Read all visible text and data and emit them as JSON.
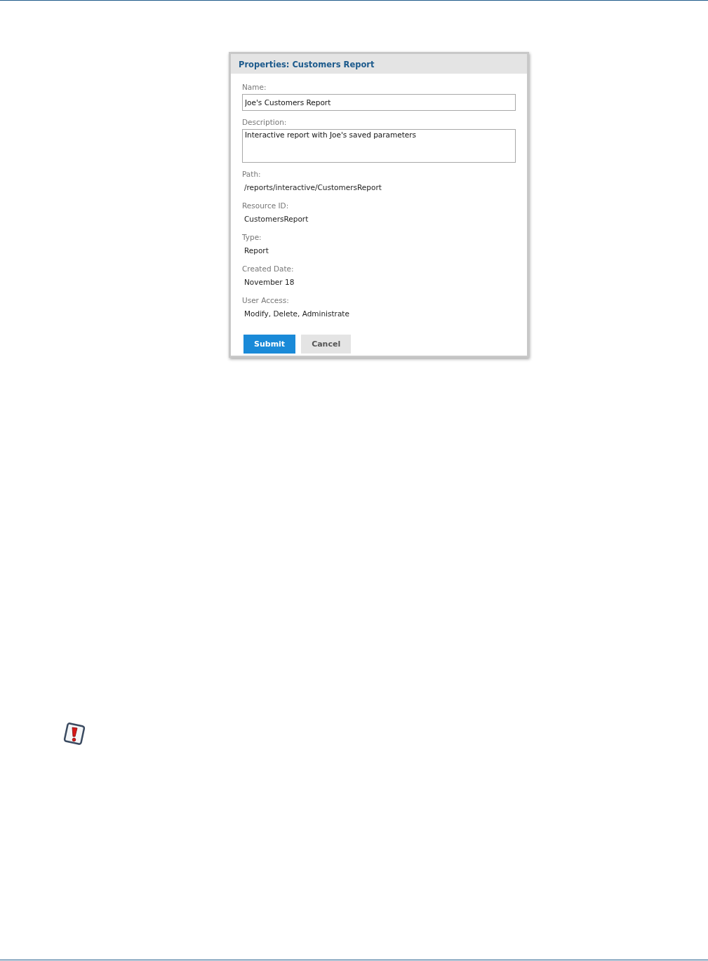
{
  "dialog": {
    "title": "Properties: Customers Report",
    "fields": [
      {
        "kind": "input",
        "label": "Name:",
        "value": "Joe's Customers Report"
      },
      {
        "kind": "textarea",
        "label": "Description:",
        "value": "Interactive report with Joe's saved parameters"
      },
      {
        "kind": "static",
        "label": "Path:",
        "value": "/reports/interactive/CustomersReport"
      },
      {
        "kind": "static",
        "label": "Resource ID:",
        "value": "CustomersReport"
      },
      {
        "kind": "static",
        "label": "Type:",
        "value": "Report"
      },
      {
        "kind": "static",
        "label": "Created Date:",
        "value": "November 18"
      },
      {
        "kind": "static",
        "label": "User Access:",
        "value": "Modify, Delete, Administrate"
      }
    ],
    "buttons": [
      {
        "kind": "primary",
        "label": "Submit"
      },
      {
        "kind": "secondary",
        "label": "Cancel"
      }
    ]
  }
}
